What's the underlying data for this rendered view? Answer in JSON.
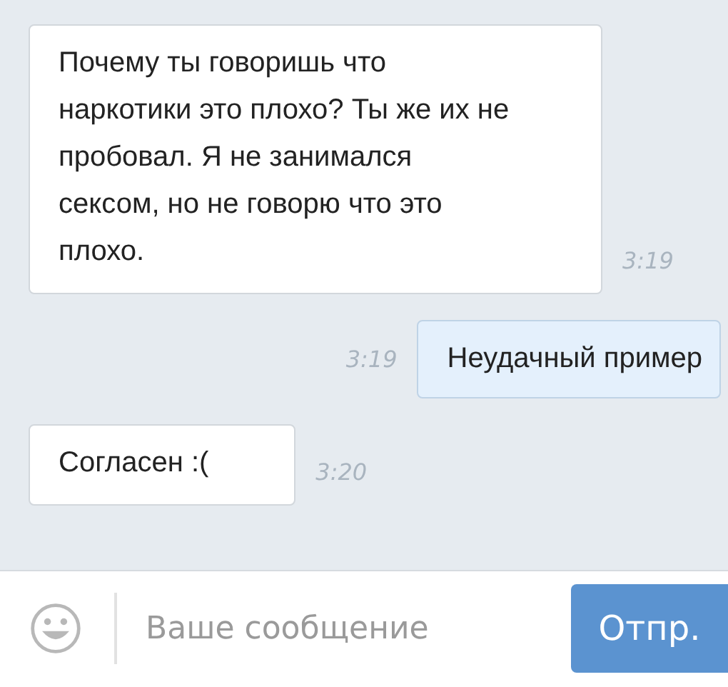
{
  "messages": [
    {
      "kind": "incoming",
      "text": "Почему ты говоришь что наркотики это плохо? Ты же их не пробовал. Я не занимался сексом, но не говорю что это плохо.",
      "time": "3:19"
    },
    {
      "kind": "outgoing",
      "text": "Неудачный пример",
      "time": "3:19"
    },
    {
      "kind": "incoming",
      "text": "Согласен :(",
      "time": "3:20"
    }
  ],
  "composer": {
    "placeholder": "Ваше сообщение",
    "send_button": "Отпр."
  }
}
